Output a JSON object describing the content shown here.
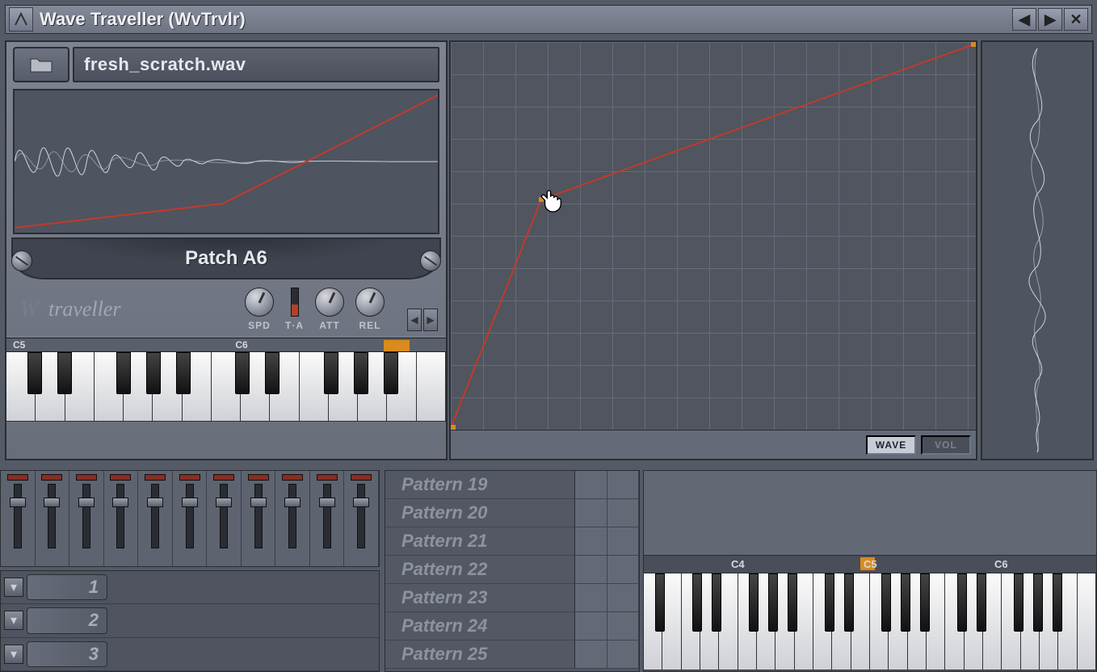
{
  "window": {
    "title": "Wave Traveller (WvTrvlr)"
  },
  "file": {
    "name": "fresh_scratch.wav"
  },
  "patch": {
    "label": "Patch A6"
  },
  "brand": {
    "text": "traveller"
  },
  "knobs": {
    "spd": "SPD",
    "ta": "T·A",
    "att": "ATT",
    "rel": "REL"
  },
  "octaves": {
    "left": "C5",
    "right": "C6"
  },
  "env_buttons": {
    "wave": "WAVE",
    "vol": "VOL"
  },
  "patterns": [
    "Pattern 19",
    "Pattern 20",
    "Pattern 21",
    "Pattern 22",
    "Pattern 23",
    "Pattern 24",
    "Pattern 25"
  ],
  "tracks": [
    "1",
    "2",
    "3"
  ],
  "pianoroll_labels": {
    "c4": "C4",
    "c5": "C5",
    "c6": "C6"
  }
}
